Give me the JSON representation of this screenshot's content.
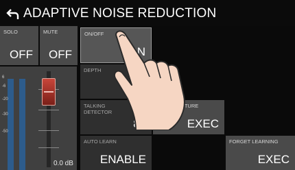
{
  "header": {
    "title": "ADAPTIVE NOISE REDUCTION",
    "back_icon": "back-arrow-icon"
  },
  "solo": {
    "label": "SOLO",
    "value": "OFF"
  },
  "mute": {
    "label": "MUTE",
    "value": "OFF"
  },
  "onoff": {
    "label": "ON/OFF",
    "value": "ON"
  },
  "depth": {
    "label": "DEPTH"
  },
  "talking_detector": {
    "label": "TALKING\nDETECTOR",
    "value": "80"
  },
  "noise_capture": {
    "label": "NOISE CAPTURE",
    "value": "EXEC"
  },
  "auto_learn": {
    "label": "AUTO LEARN",
    "value": "ENABLE"
  },
  "forget_learning": {
    "label": "FORGET LEARNING",
    "value": "EXEC"
  },
  "fader": {
    "value_text": "0.0 dB",
    "meter_ticks": [
      "6",
      "-6",
      "-20",
      "-30",
      "-50"
    ]
  },
  "colors": {
    "cell": "#4a4a4a",
    "meter": "#2d5c8c",
    "fader_knob": "#c8463a"
  }
}
